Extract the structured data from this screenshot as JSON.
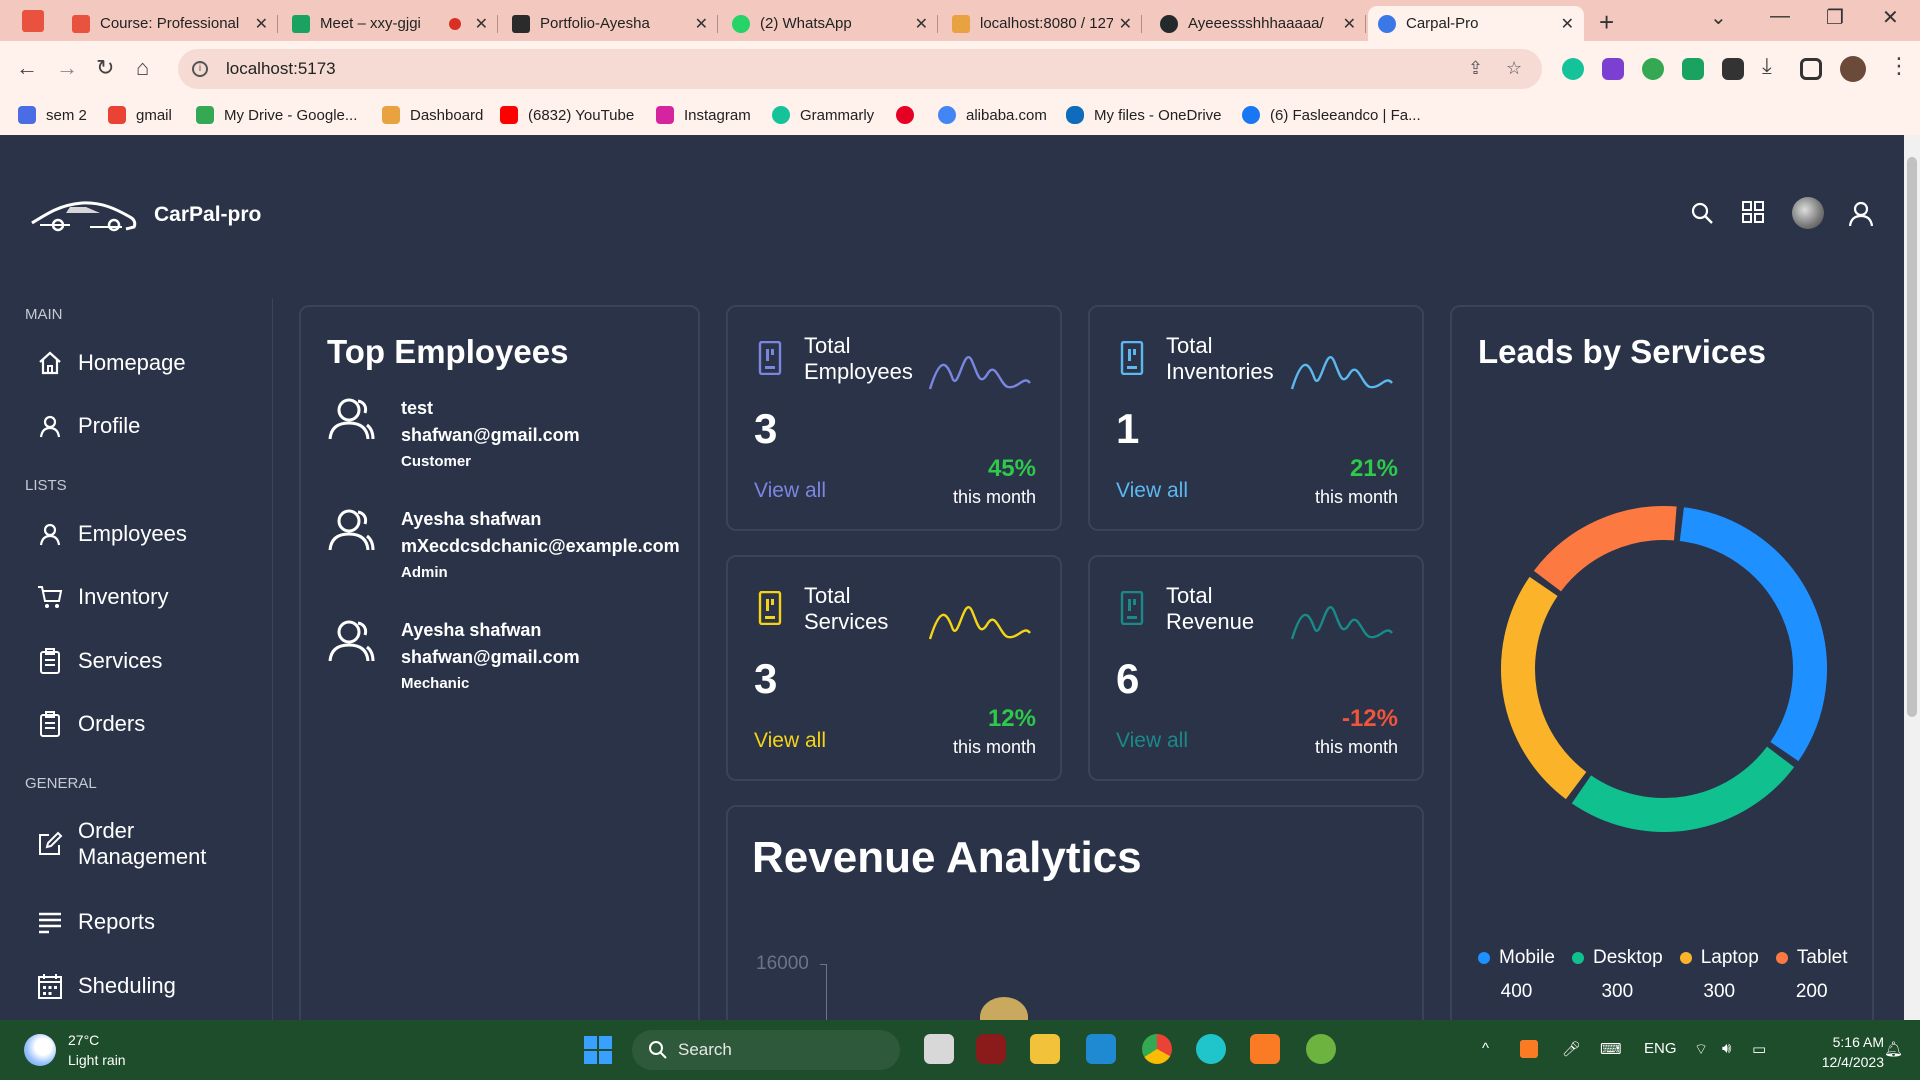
{
  "browser": {
    "tabs": [
      {
        "label": "Course: Professional",
        "color": "#e8523f"
      },
      {
        "label": "Meet – xxy-gjgi",
        "color": "#1aa260"
      },
      {
        "label": "Portfolio-Ayesha",
        "color": "#2b2b2b"
      },
      {
        "label": "(2) WhatsApp",
        "color": "#25d366"
      },
      {
        "label": "localhost:8080 / 127",
        "color": "#e8a23f"
      },
      {
        "label": "Ayeeessshhhaaaaa/",
        "color": "#24292e"
      },
      {
        "label": "Carpal-Pro",
        "color": "#3b78e7"
      }
    ],
    "url": "localhost:5173",
    "bookmarks": [
      {
        "label": "sem 2",
        "color": "#4a6de5"
      },
      {
        "label": "gmail",
        "color": "#ea4335"
      },
      {
        "label": "My Drive - Google...",
        "color": "#34a853"
      },
      {
        "label": "Dashboard",
        "color": "#e8a23f"
      },
      {
        "label": "(6832) YouTube",
        "color": "#ff0000"
      },
      {
        "label": "Instagram",
        "color": "#d6249f"
      },
      {
        "label": "Grammarly",
        "color": "#15c39a"
      },
      {
        "label": "",
        "color": "#e60023"
      },
      {
        "label": "alibaba.com",
        "color": "#4285f4"
      },
      {
        "label": "My files - OneDrive",
        "color": "#0f6cbd"
      },
      {
        "label": "(6) Fasleeandco | Fa...",
        "color": "#1877f2"
      }
    ]
  },
  "app": {
    "brand": "CarPal-pro",
    "sidebar": {
      "main_label": "MAIN",
      "lists_label": "LISTS",
      "general_label": "GENERAL",
      "items": [
        {
          "label": "Homepage",
          "icon": "home-icon"
        },
        {
          "label": "Profile",
          "icon": "user-icon"
        },
        {
          "label": "Employees",
          "icon": "user-icon"
        },
        {
          "label": "Inventory",
          "icon": "cart-icon"
        },
        {
          "label": "Services",
          "icon": "clipboard-icon"
        },
        {
          "label": "Orders",
          "icon": "clipboard-icon"
        },
        {
          "label": "Order Management",
          "icon": "edit-icon"
        },
        {
          "label": "Reports",
          "icon": "list-icon"
        },
        {
          "label": "Sheduling",
          "icon": "calendar-icon"
        }
      ]
    },
    "top_employees": {
      "title": "Top Employees",
      "employees": [
        {
          "name": "test",
          "email": "shafwan@gmail.com",
          "role": "Customer"
        },
        {
          "name": "Ayesha shafwan",
          "email": "mXecdcsdchanic@example.com",
          "role": "Admin"
        },
        {
          "name": "Ayesha shafwan",
          "email": "shafwan@gmail.com",
          "role": "Mechanic"
        }
      ]
    },
    "stats": [
      {
        "title_line1": "Total",
        "title_line2": "Employees",
        "value": "3",
        "view": "View all",
        "pct": "45%",
        "period": "this month",
        "color": "#7b86e0",
        "pct_color": "#2ec94a"
      },
      {
        "title_line1": "Total",
        "title_line2": "Inventories",
        "value": "1",
        "view": "View all",
        "pct": "21%",
        "period": "this month",
        "color": "#5bb8f0",
        "pct_color": "#2ec94a"
      },
      {
        "title_line1": "Total",
        "title_line2": "Services",
        "value": "3",
        "view": "View all",
        "pct": "12%",
        "period": "this month",
        "color": "#f5d316",
        "pct_color": "#2ec94a"
      },
      {
        "title_line1": "Total",
        "title_line2": "Revenue",
        "value": "6",
        "view": "View all",
        "pct": "-12%",
        "period": "this month",
        "color": "#1a8a88",
        "pct_color": "#f0543c"
      }
    ],
    "revenue": {
      "title": "Revenue Analytics",
      "y_tick": "16000"
    },
    "leads": {
      "title": "Leads by Services",
      "segments": [
        {
          "name": "Mobile",
          "value": 400,
          "color": "#1e90ff"
        },
        {
          "name": "Desktop",
          "value": 300,
          "color": "#10c18f"
        },
        {
          "name": "Laptop",
          "value": 300,
          "color": "#fbb42a"
        },
        {
          "name": "Tablet",
          "value": 200,
          "color": "#fc7a42"
        }
      ]
    }
  },
  "taskbar": {
    "temp": "27°C",
    "weather": "Light rain",
    "search_label": "Search",
    "lang": "ENG",
    "time": "5:16 AM",
    "date": "12/4/2023"
  }
}
